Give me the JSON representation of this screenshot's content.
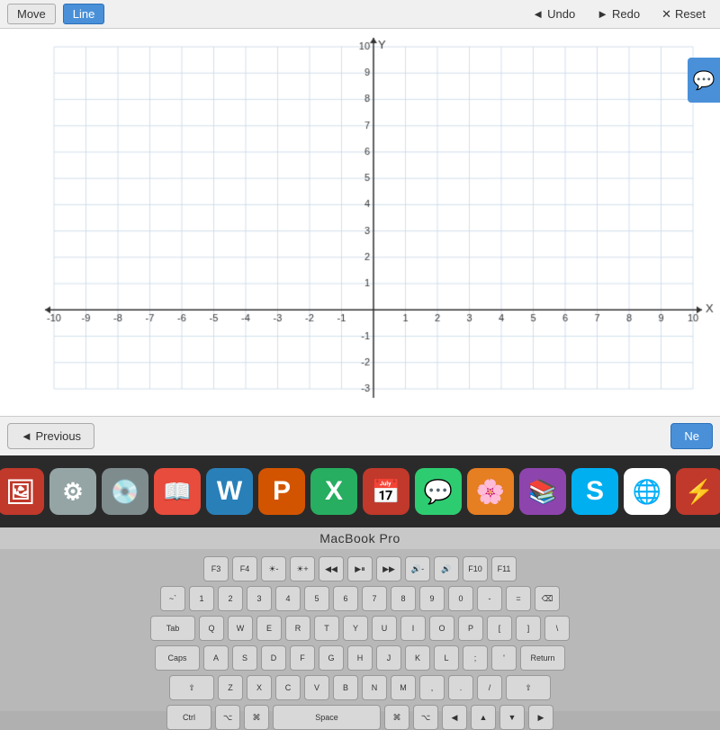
{
  "toolbar": {
    "move_label": "Move",
    "line_label": "Line",
    "undo_label": "Undo",
    "redo_label": "Redo",
    "reset_label": "Reset"
  },
  "graph": {
    "x_min": -10,
    "x_max": 10,
    "y_min": -3,
    "y_max": 10,
    "x_label": "X",
    "y_label": "Y"
  },
  "navigation": {
    "previous_label": "◄ Previous",
    "next_label": "Ne"
  },
  "macbook": {
    "label": "MacBook Pro"
  },
  "dock": {
    "items": [
      {
        "name": "photos-collage",
        "emoji": "🖼",
        "bg": "#c0392b"
      },
      {
        "name": "settings",
        "emoji": "⚙️",
        "bg": "#7f8c8d"
      },
      {
        "name": "dvd-player",
        "emoji": "💿",
        "bg": "#95a5a6"
      },
      {
        "name": "dictionary",
        "emoji": "📖",
        "bg": "#e74c3c"
      },
      {
        "name": "word",
        "emoji": "W",
        "bg": "#3498db"
      },
      {
        "name": "powerpoint",
        "emoji": "P",
        "bg": "#e67e22"
      },
      {
        "name": "excel",
        "emoji": "X",
        "bg": "#27ae60"
      },
      {
        "name": "calendar",
        "emoji": "📅",
        "bg": "#e74c3c"
      },
      {
        "name": "messages",
        "emoji": "💬",
        "bg": "#2ecc71"
      },
      {
        "name": "photos",
        "emoji": "🌸",
        "bg": "#f39c12"
      },
      {
        "name": "ibooks",
        "emoji": "📚",
        "bg": "#8e44ad"
      },
      {
        "name": "skype",
        "emoji": "S",
        "bg": "#00aff0"
      },
      {
        "name": "chrome",
        "emoji": "🌐",
        "bg": "#fff"
      },
      {
        "name": "flash",
        "emoji": "⚡",
        "bg": "#c0392b"
      }
    ]
  },
  "keyboard": {
    "row1": [
      "F3",
      "F4",
      "☀-",
      "☀+",
      "◀◀",
      "▶⏸",
      "▶▶",
      "🔊-",
      "🔊",
      "F10",
      "F11"
    ],
    "row2": [
      "~`",
      "1",
      "2",
      "3",
      "4",
      "5",
      "6",
      "7",
      "8",
      "9",
      "0",
      "-",
      "=",
      "⌫"
    ],
    "row3": [
      "Tab",
      "Q",
      "W",
      "E",
      "R",
      "T",
      "Y",
      "U",
      "I",
      "O",
      "P",
      "[",
      "]",
      "\\"
    ],
    "row4": [
      "Caps",
      "A",
      "S",
      "D",
      "F",
      "G",
      "H",
      "J",
      "K",
      "L",
      ";",
      "'",
      "Return"
    ],
    "row5": [
      "⇧",
      "Z",
      "X",
      "C",
      "V",
      "B",
      "N",
      "M",
      ",",
      ".",
      "/",
      "⇧"
    ],
    "row6": [
      "Ctrl",
      "⌥",
      "⌘",
      "Space",
      "⌘",
      "⌥",
      "◀",
      "▲",
      "▼",
      "▶"
    ]
  }
}
